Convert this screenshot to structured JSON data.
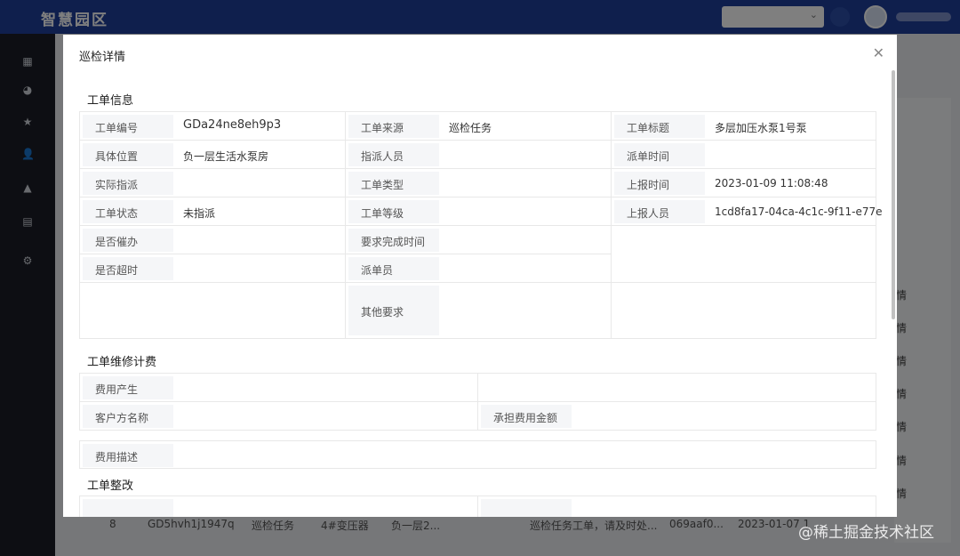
{
  "app": {
    "title": "智慧园区"
  },
  "background": {
    "row": {
      "index": "8",
      "code": "GD5hvh1j1947q",
      "source": "巡检任务",
      "device": "4#变压器",
      "location": "负一层2...",
      "desc": "巡检任务工单，请及时处...",
      "id": "069aaf0...",
      "time": "2023-01-07 1"
    },
    "detail_btn": "情"
  },
  "watermark": "@稀土掘金技术社区",
  "modal": {
    "title": "巡检详情",
    "close_icon": "close-icon",
    "sections": {
      "order_info": "工单信息",
      "fees": "工单维修计费",
      "rectify": "工单整改"
    },
    "order_info": {
      "order_no_label": "工单编号",
      "order_no": "GDa24ne8eh9p3",
      "source_label": "工单来源",
      "source": "巡检任务",
      "title_label": "工单标题",
      "title": "多层加压水泵1号泵",
      "location_label": "具体位置",
      "location": "负一层生活水泵房",
      "assignee_label": "指派人员",
      "assignee": "",
      "dispatch_time_label": "派单时间",
      "dispatch_time": "",
      "actual_assign_label": "实际指派",
      "actual_assign": "",
      "type_label": "工单类型",
      "type": "",
      "report_time_label": "上报时间",
      "report_time": "2023-01-09 11:08:48",
      "status_label": "工单状态",
      "status": "未指派",
      "level_label": "工单等级",
      "level": "",
      "reporter_label": "上报人员",
      "reporter": "1cd8fa17-04ca-4c1c-9f11-e77e",
      "urge_label": "是否催办",
      "urge": "",
      "deadline_label": "要求完成时间",
      "deadline": "",
      "overdue_label": "是否超时",
      "overdue": "",
      "dispatcher_label": "派单员",
      "dispatcher": "",
      "other_label": "其他要求",
      "other": ""
    },
    "fees": {
      "fee_produced_label": "费用产生",
      "fee_produced": "",
      "customer_label": "客户方名称",
      "customer": "",
      "amount_label": "承担费用金额",
      "amount": "",
      "desc_label": "费用描述",
      "desc": ""
    }
  }
}
